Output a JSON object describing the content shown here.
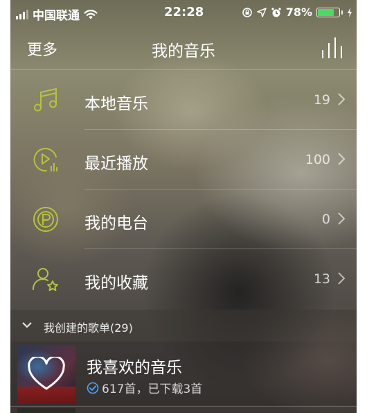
{
  "status_bar": {
    "carrier": "中国联通",
    "time": "22:28",
    "battery_percent": "78%",
    "battery_level": 0.78,
    "icons": [
      "signal-icon",
      "wifi-icon",
      "lock-rotation-icon",
      "location-icon",
      "alarm-icon",
      "battery-icon",
      "charging-icon"
    ]
  },
  "nav": {
    "more_label": "更多",
    "title": "我的音乐",
    "equalizer_icon": "equalizer-icon"
  },
  "menu": [
    {
      "label": "本地音乐",
      "count": "19",
      "icon": "music-note-icon"
    },
    {
      "label": "最近播放",
      "count": "100",
      "icon": "recent-play-icon"
    },
    {
      "label": "我的电台",
      "count": "0",
      "icon": "radio-icon"
    },
    {
      "label": "我的收藏",
      "count": "13",
      "icon": "favorite-user-icon"
    }
  ],
  "section": {
    "title": "我创建的歌单(29)"
  },
  "playlist": {
    "name": "我喜欢的音乐",
    "subtitle": "617首，已下载3首"
  },
  "colors": {
    "accent_green": "#b5c43a",
    "check_blue": "#4aa3ff",
    "battery_green": "#4cd964"
  }
}
